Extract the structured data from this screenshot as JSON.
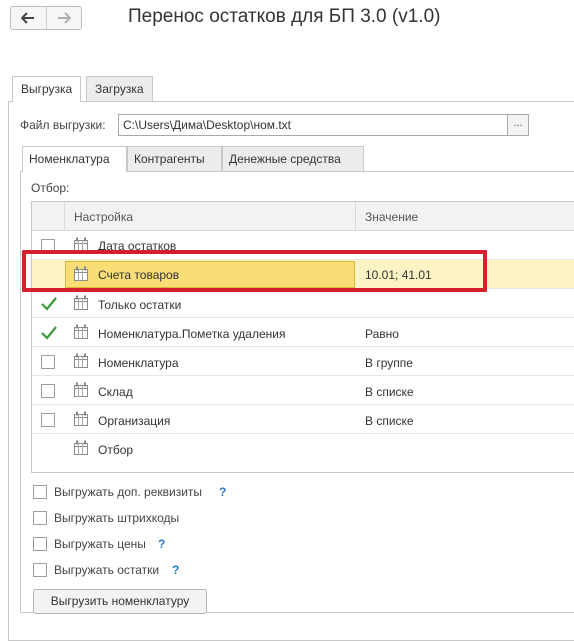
{
  "window": {
    "title": "Перенос остатков для БП 3.0 (v1.0)"
  },
  "tabs": [
    {
      "label": "Выгрузка",
      "active": true
    },
    {
      "label": "Загрузка",
      "active": false
    }
  ],
  "export_file": {
    "label": "Файл выгрузки:",
    "value": "C:\\Users\\Дима\\Desktop\\ном.txt",
    "browse_label": "..."
  },
  "subtabs": [
    {
      "label": "Номенклатура",
      "active": true
    },
    {
      "label": "Контрагенты",
      "active": false
    },
    {
      "label": "Денежные средства",
      "active": false
    }
  ],
  "filter": {
    "label": "Отбор:",
    "columns": {
      "setting": "Настройка",
      "value": "Значение"
    },
    "rows": [
      {
        "name": "Дата остатков",
        "value": "",
        "checked": false,
        "has_checkbox": true
      },
      {
        "name": "Счета товаров",
        "value": "10.01; 41.01",
        "checked": false,
        "has_checkbox": false,
        "selected": true
      },
      {
        "name": "Только остатки",
        "value": "",
        "checked": true,
        "has_checkbox": true
      },
      {
        "name": "Номенклатура.Пометка удаления",
        "value": "Равно",
        "checked": true,
        "has_checkbox": true
      },
      {
        "name": "Номенклатура",
        "value": "В группе",
        "checked": false,
        "has_checkbox": true
      },
      {
        "name": "Склад",
        "value": "В списке",
        "checked": false,
        "has_checkbox": true
      },
      {
        "name": "Организация",
        "value": "В списке",
        "checked": false,
        "has_checkbox": true
      },
      {
        "name": "Отбор",
        "value": "",
        "checked": false,
        "has_checkbox": false
      }
    ]
  },
  "options": [
    {
      "label": "Выгружать доп. реквизиты",
      "help": "?",
      "checked": false
    },
    {
      "label": "Выгружать штрихкоды",
      "help": "",
      "checked": false
    },
    {
      "label": "Выгружать цены",
      "help": "?",
      "checked": false
    },
    {
      "label": "Выгружать остатки",
      "help": "?",
      "checked": false
    }
  ],
  "actions": {
    "export_button": "Выгрузить номенклатуру"
  },
  "icons": {
    "back": "arrow-left-icon",
    "forward": "arrow-right-icon",
    "row_item": "table-setting-icon",
    "check": "check-icon"
  },
  "colors": {
    "highlight_border": "#d2212d",
    "selected_row": "#fbf3c3",
    "selected_cell": "#f8de74",
    "check": "#3a9a3a",
    "help": "#2b7bc9"
  }
}
